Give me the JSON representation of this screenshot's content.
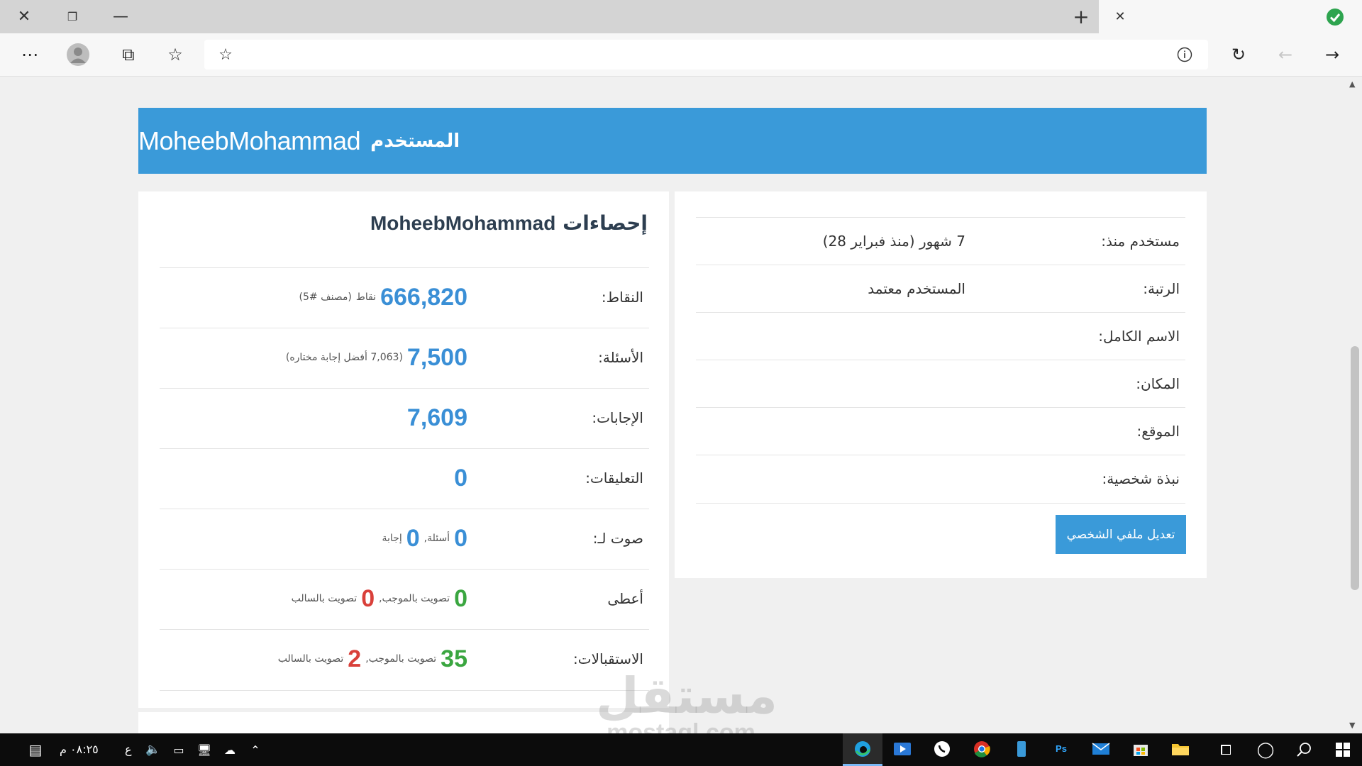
{
  "browser": {
    "address_value": "",
    "address_placeholder": ""
  },
  "banner": {
    "label": "المستخدم",
    "username": "MoheebMohammad"
  },
  "profile": {
    "rows": [
      {
        "label": "مستخدم منذ:",
        "value": "7 شهور (منذ فبراير 28)"
      },
      {
        "label": "الرتبة:",
        "value": "المستخدم معتمد"
      },
      {
        "label": "الاسم الكامل:",
        "value": ""
      },
      {
        "label": "المكان:",
        "value": ""
      },
      {
        "label": "الموقع:",
        "value": ""
      },
      {
        "label": "نبذة شخصية:",
        "value": ""
      }
    ],
    "edit_button": "تعديل ملفي الشخصي"
  },
  "stats": {
    "title_prefix": "إحصاءات",
    "title_name": "MoheebMohammad",
    "points": {
      "label": "النقاط:",
      "value": "666,820",
      "unit": "نقاط",
      "extra": "(مصنف #5)"
    },
    "questions": {
      "label": "الأسئلة:",
      "value": "7,500",
      "extra": "(7,063 أفضل إجابة مختاره)"
    },
    "answers": {
      "label": "الإجابات:",
      "value": "7,609"
    },
    "comments": {
      "label": "التعليقات:",
      "value": "0"
    },
    "voted_on": {
      "label": "صوت لـ:",
      "q_value": "0",
      "q_text": "أسئلة,",
      "a_value": "0",
      "a_text": "إجابة"
    },
    "gave": {
      "label": "أعطى",
      "up_value": "0",
      "up_text": "تصويت بالموجب,",
      "down_value": "0",
      "down_text": "تصويت بالسالب"
    },
    "received": {
      "label": "الاستقبالات:",
      "up_value": "35",
      "up_text": "تصويت بالموجب,",
      "down_value": "2",
      "down_text": "تصويت بالسالب"
    }
  },
  "watermark": {
    "arabic": "مستقل",
    "latin": "mostaql.com"
  },
  "taskbar": {
    "clock": "٠٨:٢٥ م",
    "lang": "ع"
  }
}
